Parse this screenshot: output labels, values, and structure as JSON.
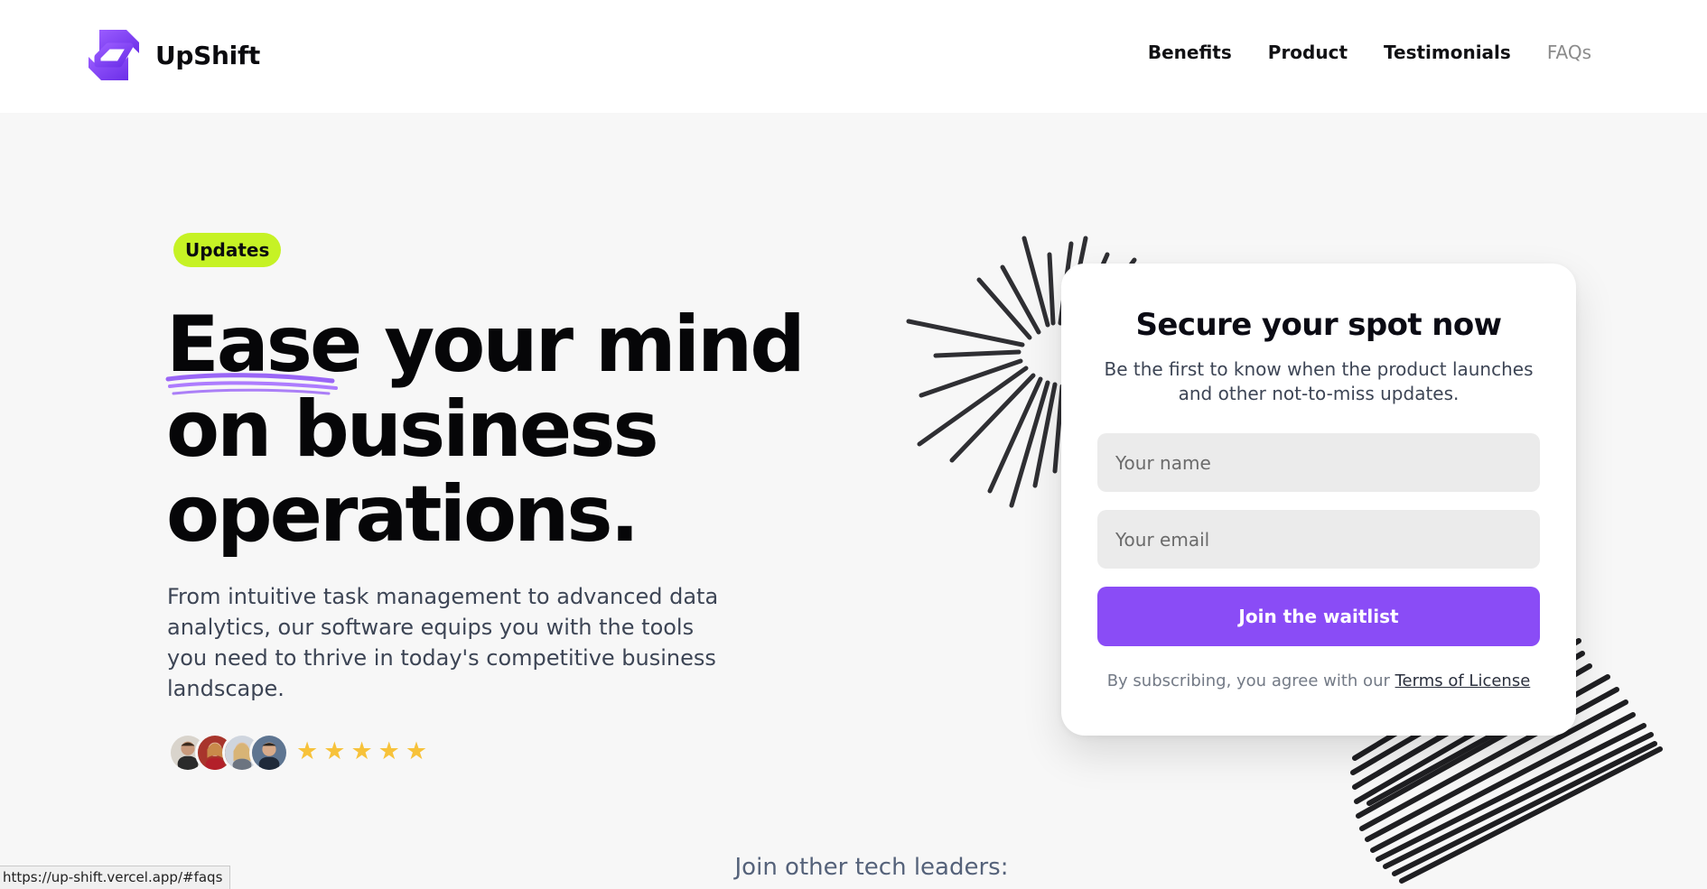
{
  "header": {
    "brand_name": "UpShift",
    "logo_icon": "upshift-logo-icon",
    "nav": [
      {
        "label": "Benefits",
        "active": false
      },
      {
        "label": "Product",
        "active": false
      },
      {
        "label": "Testimonials",
        "active": false
      },
      {
        "label": "FAQs",
        "active": true
      }
    ]
  },
  "hero": {
    "badge": "Updates",
    "headline": "Ease your mind on business operations.",
    "subheading": "From intuitive task management to advanced data analytics, our software equips you with the tools you need to thrive in today's competitive business landscape.",
    "rating": 5,
    "rating_icon": "star-icon",
    "avatar_count": 4
  },
  "signup_form": {
    "title": "Secure your spot now",
    "subtitle": "Be the first to know when the product launches and other not-to-miss updates.",
    "name_placeholder": "Your name",
    "email_placeholder": "Your email",
    "submit_label": "Join the waitlist",
    "legal_prefix": "By subscribing, you agree with our",
    "legal_link": "Terms of License"
  },
  "bottom": {
    "leaders_heading": "Join other tech leaders:"
  },
  "browser_status": {
    "url": "https://up-shift.vercel.app/#faqs"
  },
  "colors": {
    "accent": "#8a4cf6",
    "badge": "#c6f225",
    "star": "#f7c23a",
    "page_bg": "#f7f7f7"
  }
}
